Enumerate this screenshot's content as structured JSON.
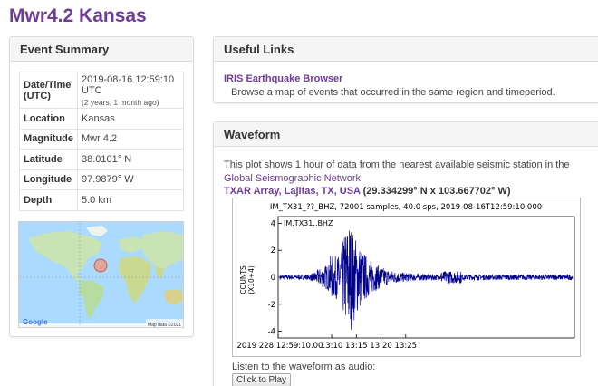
{
  "page": {
    "title": "Mwr4.2 Kansas"
  },
  "summary": {
    "heading": "Event Summary",
    "rows": [
      {
        "key": "Date/Time (UTC)",
        "value": "2019-08-16 12:59:10 UTC",
        "note": "(2 years, 1 month ago)"
      },
      {
        "key": "Location",
        "value": "Kansas"
      },
      {
        "key": "Magnitude",
        "value": "Mwr 4.2"
      },
      {
        "key": "Latitude",
        "value": "38.0101° N"
      },
      {
        "key": "Longitude",
        "value": "97.9879° W"
      },
      {
        "key": "Depth",
        "value": "5.0 km"
      }
    ],
    "map": {
      "google_logo": "Google",
      "credit": "Map data ©2021"
    }
  },
  "links": {
    "heading": "Useful Links",
    "link_text": "IRIS Earthquake Browser",
    "link_desc": "Browse a map of events that occurred in the same region and timeperiod."
  },
  "waveform": {
    "heading": "Waveform",
    "desc_prefix": "This plot shows 1 hour of data from the nearest available seismic station in the ",
    "desc_link": "Global Seismographic Network",
    "desc_suffix": ".",
    "station_name": "TXAR Array, Lajitas, TX, USA",
    "station_coords": "(29.334299° N x 103.667702° W)",
    "plot_header": "IM_TX31_??_BHZ, 72001 samples, 40.0 sps, 2019-08-16T12:59:10.000",
    "trace_label": "IM.TX31..BHZ",
    "y_label_1": "COUNTS",
    "y_label_2": "(X10+4)",
    "audio_label": "Listen to the waveform as audio:",
    "play_label": "Click to Play"
  },
  "chart_data": {
    "type": "line",
    "title": "IM_TX31_??_BHZ, 72001 samples, 40.0 sps, 2019-08-16T12:59:10.000",
    "ylabel": "COUNTS (X10+4)",
    "ylim": [
      -4.5,
      4.5
    ],
    "yticks": [
      4,
      2,
      0,
      -2,
      -4
    ],
    "xticks": [
      "2019 228 12:59:10.00",
      "13:10",
      "13:15",
      "13:20",
      "13:25"
    ],
    "series": [
      {
        "name": "IM.TX31..BHZ"
      }
    ]
  },
  "colors": {
    "accent": "#6f3c96",
    "trace": "#00008b",
    "marker": "#e8a090"
  }
}
